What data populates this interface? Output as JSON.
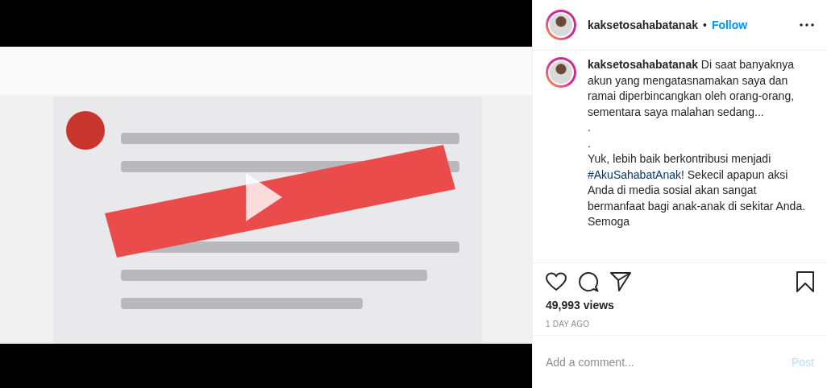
{
  "header": {
    "username": "kaksetosahabatanak",
    "separator": "•",
    "follow": "Follow"
  },
  "caption": {
    "author": "kaksetosahabatanak",
    "paragraphs": [
      [
        {
          "kind": "text",
          "text": "Di saat banyaknya akun yang mengatasnamakan saya dan ramai diperbincangkan oleh orang-orang, sementara saya malahan sedang..."
        }
      ],
      [
        {
          "kind": "text",
          "text": "."
        }
      ],
      [
        {
          "kind": "text",
          "text": "."
        }
      ],
      [
        {
          "kind": "text",
          "text": "Yuk, lebih baik berkontribusi menjadi "
        },
        {
          "kind": "hashtag",
          "text": "#AkuSahabatAnak"
        },
        {
          "kind": "text",
          "text": "! Sekecil apapun aksi Anda di media sosial akan sangat bermanfaat bagi anak-anak di sekitar Anda. Semoga"
        }
      ]
    ]
  },
  "views": "49,993 views",
  "time": "1 DAY AGO",
  "comment": {
    "placeholder": "Add a comment...",
    "post": "Post",
    "post_disabled": true
  }
}
